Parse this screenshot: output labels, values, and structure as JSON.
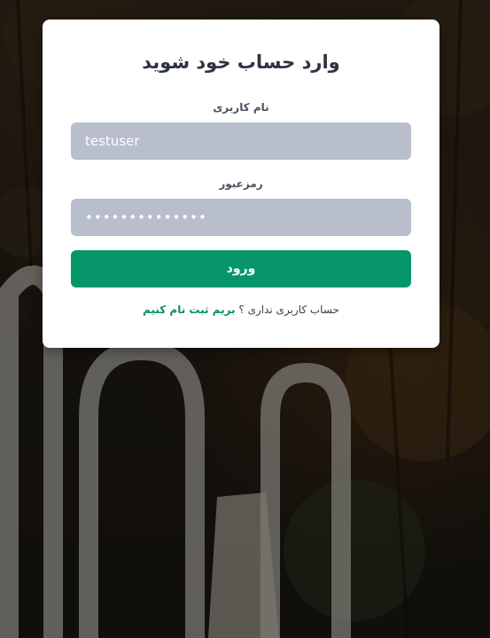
{
  "login": {
    "title": "وارد حساب خود شوید",
    "username_label": "نام کاربری",
    "username_value": "testuser",
    "password_label": "رمزعبور",
    "password_value": "••••••••••••••",
    "submit_label": "ورود",
    "no_account_text": "حساب کاربری نداری ؟",
    "signup_link": "بریم ثبت نام کنیم"
  },
  "colors": {
    "accent": "#07966a",
    "input_bg": "#b8becb",
    "card_bg": "#ffffff"
  }
}
